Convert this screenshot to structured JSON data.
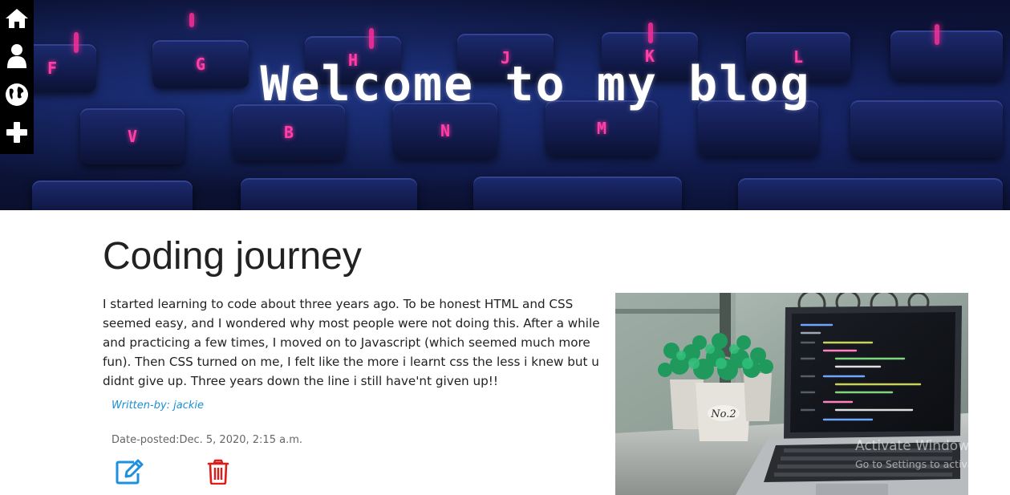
{
  "hero": {
    "title": "Welcome to my blog",
    "key_letters": [
      "F",
      "G",
      "H",
      "J",
      "K",
      "L",
      "V",
      "B",
      "N",
      "M"
    ]
  },
  "sidebar": {
    "items": [
      {
        "icon": "home-icon"
      },
      {
        "icon": "user-icon"
      },
      {
        "icon": "globe-icon"
      },
      {
        "icon": "plus-icon"
      }
    ]
  },
  "post": {
    "title": "Coding journey",
    "body": "I started learning to code about three years ago. To be honest HTML and CSS seemed easy, and I wondered why most people were not doing this. After a while and practicing a few times, I moved on to Javascript (which seemed much more fun). Then CSS turned on me, I felt like the more i learnt css the less i knew but u didnt give up. Three years down the line i still have'nt given up!!",
    "author": "Written-by: jackie",
    "date": "Date-posted:Dec. 5, 2020, 2:15 a.m.",
    "actions": {
      "edit_icon": "edit-icon",
      "delete_icon": "trash-icon"
    },
    "image_label": "No.2"
  },
  "watermark": {
    "title": "Activate Windows",
    "subtitle": "Go to Settings to activate Windows."
  },
  "colors": {
    "author": "#1a8fd6",
    "edit": "#1e90e0",
    "delete": "#e11a1a",
    "key_glow": "#ff2f9a"
  }
}
